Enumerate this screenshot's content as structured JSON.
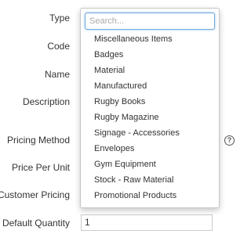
{
  "form": {
    "labels": {
      "type": "Type",
      "code": "Code",
      "name": "Name",
      "description": "Description",
      "pricing_method": "Pricing Method",
      "price_per_unit": "Price Per Unit",
      "customer_pricing": "Customer Pricing",
      "default_quantity": "Default Quantity"
    },
    "default_quantity_value": "1",
    "help_icon_glyph": "?"
  },
  "type_dropdown": {
    "search_placeholder": "Search...",
    "options": [
      "Miscellaneous Items",
      "Badges",
      "Material",
      "Manufactured",
      "Rugby Books",
      "Rugby Magazine",
      "Signage - Accessories",
      "Envelopes",
      "Gym Equipment",
      "Stock - Raw Material",
      "Promotional Products"
    ]
  },
  "colors": {
    "focus_border": "#66afe9",
    "label_text": "#333333"
  }
}
